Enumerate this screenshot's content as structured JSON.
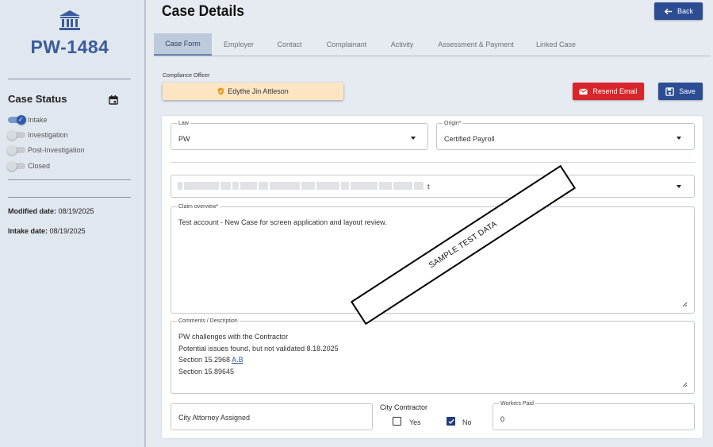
{
  "sidebar": {
    "case_id": "PW-1484",
    "case_status_title": "Case Status",
    "statuses": [
      {
        "label": "Intake",
        "on": true
      },
      {
        "label": "Investigation",
        "on": false
      },
      {
        "label": "Post-Investigation",
        "on": false
      },
      {
        "label": "Closed",
        "on": false
      }
    ],
    "modified_label": "Modified date:",
    "modified_value": "08/19/2025",
    "intake_label": "Intake date:",
    "intake_value": "08/19/2025"
  },
  "header": {
    "title": "Case Details",
    "back_label": "Back"
  },
  "tabs": [
    {
      "label": "Case Form",
      "active": true
    },
    {
      "label": "Employer",
      "active": false
    },
    {
      "label": "Contact",
      "active": false
    },
    {
      "label": "Complainant",
      "active": false
    },
    {
      "label": "Activity",
      "active": false
    },
    {
      "label": "Assessment & Payment",
      "active": false
    },
    {
      "label": "Linked Case",
      "active": false
    }
  ],
  "compliance": {
    "label": "Compliance Officer",
    "officer": "Edythe Jin Attleson"
  },
  "actions": {
    "resend_label": "Resend Email",
    "save_label": "Save"
  },
  "form": {
    "law_label": "Law",
    "law_value": "PW",
    "origin_label": "Origin*",
    "origin_value": "Certified Payroll",
    "redacted_suffix": "t",
    "claim_label": "Claim overview*",
    "claim_value": "Test account - New Case for screen application and layout review.",
    "comments_label": "Comments / Description",
    "comments_lines": [
      "PW challenges with the Contractor",
      "Potential issues found, but not validated 8.18.2025",
      "Section 15.2968 ",
      "Section 15.89645"
    ],
    "comments_link": "A.B",
    "city_attorney_label": "City Attorney Assigned",
    "city_contractor_label": "City Contractor",
    "yes_label": "Yes",
    "no_label": "No",
    "yes_checked": false,
    "no_checked": true,
    "workers_paid_label": "Workers Paid",
    "workers_paid_value": "0"
  },
  "stamp": {
    "text": "SAMPLE TEST DATA"
  },
  "colors": {
    "primary": "#2c4d94",
    "danger": "#d7262b",
    "accent_text": "#3a5c9c",
    "officer_bg": "#fde5c4"
  },
  "icons": [
    "bank-icon",
    "calendar-icon",
    "arrow-left-icon",
    "mail-icon",
    "save-icon",
    "shield-icon",
    "chevron-down-icon",
    "checkmark-icon",
    "resize-grip-icon"
  ]
}
